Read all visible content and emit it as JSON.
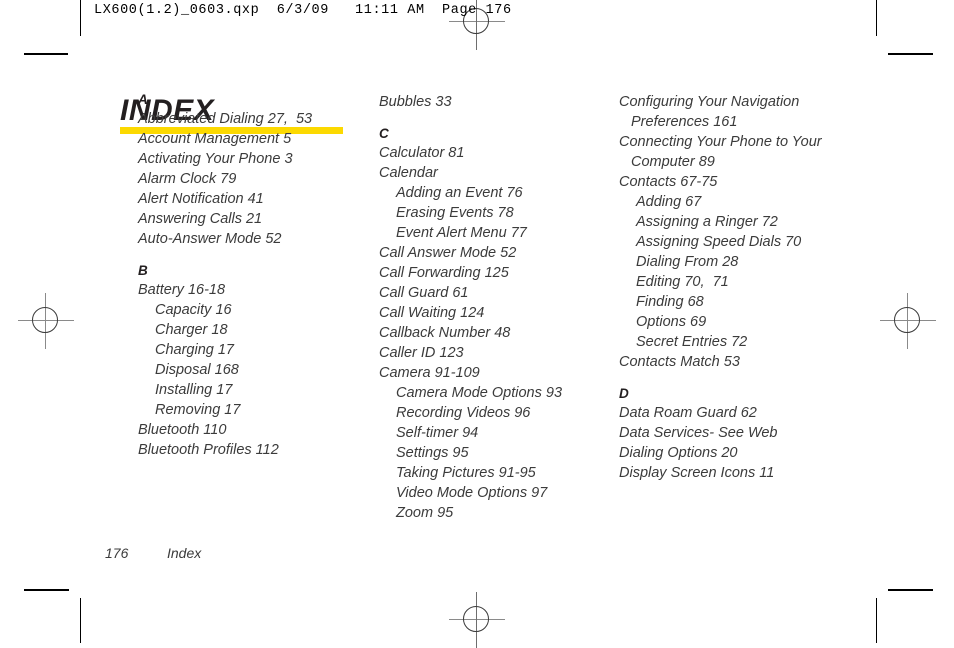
{
  "prepress": {
    "header_text": "LX600(1.2)_0603.qxp  6/3/09   11:11 AM  Page 176"
  },
  "page": {
    "title": "INDEX",
    "footer": {
      "page_number": "176",
      "section_label": "Index"
    }
  },
  "columns": [
    {
      "id": "column-1",
      "blocks": [
        {
          "heading": "A",
          "entries": [
            {
              "text": "Abbreviated Dialing 27,  53",
              "level": 1
            },
            {
              "text": "Account Management 5",
              "level": 1
            },
            {
              "text": "Activating Your Phone 3",
              "level": 1
            },
            {
              "text": "Alarm Clock 79",
              "level": 1
            },
            {
              "text": "Alert Notification 41",
              "level": 1
            },
            {
              "text": "Answering Calls 21",
              "level": 1
            },
            {
              "text": "Auto-Answer Mode 52",
              "level": 1
            }
          ]
        },
        {
          "heading": "B",
          "entries": [
            {
              "text": "Battery 16-18",
              "level": 1
            },
            {
              "text": "Capacity 16",
              "level": 2
            },
            {
              "text": "Charger 18",
              "level": 2
            },
            {
              "text": "Charging 17",
              "level": 2
            },
            {
              "text": "Disposal 168",
              "level": 2
            },
            {
              "text": "Installing 17",
              "level": 2
            },
            {
              "text": "Removing 17",
              "level": 2
            },
            {
              "text": "Bluetooth 110",
              "level": 1
            },
            {
              "text": "Bluetooth Profiles 112",
              "level": 1
            }
          ]
        }
      ]
    },
    {
      "id": "column-2",
      "blocks": [
        {
          "heading": null,
          "entries": [
            {
              "text": "Bubbles 33",
              "level": 1
            }
          ]
        },
        {
          "heading": "C",
          "entries": [
            {
              "text": "Calculator 81",
              "level": 1
            },
            {
              "text": "Calendar",
              "level": 1
            },
            {
              "text": "Adding an Event 76",
              "level": 2
            },
            {
              "text": "Erasing Events 78",
              "level": 2
            },
            {
              "text": "Event Alert Menu 77",
              "level": 2
            },
            {
              "text": "Call Answer Mode 52",
              "level": 1
            },
            {
              "text": "Call Forwarding 125",
              "level": 1
            },
            {
              "text": "Call Guard 61",
              "level": 1
            },
            {
              "text": "Call Waiting 124",
              "level": 1
            },
            {
              "text": "Callback Number 48",
              "level": 1
            },
            {
              "text": "Caller ID 123",
              "level": 1
            },
            {
              "text": "Camera 91-109",
              "level": 1
            },
            {
              "text": "Camera Mode Options 93",
              "level": 2
            },
            {
              "text": "Recording Videos 96",
              "level": 2
            },
            {
              "text": "Self-timer 94",
              "level": 2
            },
            {
              "text": "Settings 95",
              "level": 2
            },
            {
              "text": "Taking Pictures 91-95",
              "level": 2
            },
            {
              "text": "Video Mode Options 97",
              "level": 2
            },
            {
              "text": "Zoom 95",
              "level": 2
            }
          ]
        }
      ]
    },
    {
      "id": "column-3",
      "blocks": [
        {
          "heading": null,
          "entries": [
            {
              "text": "Configuring Your Navigation Preferences 161",
              "level": 1,
              "wrap": true
            },
            {
              "text": "Connecting Your Phone to Your Computer 89",
              "level": 1,
              "wrap": true
            },
            {
              "text": "Contacts 67-75",
              "level": 1
            },
            {
              "text": "Adding 67",
              "level": 2
            },
            {
              "text": "Assigning a Ringer 72",
              "level": 2
            },
            {
              "text": "Assigning Speed Dials 70",
              "level": 2
            },
            {
              "text": "Dialing From 28",
              "level": 2
            },
            {
              "text": "Editing 70,  71",
              "level": 2
            },
            {
              "text": "Finding 68",
              "level": 2
            },
            {
              "text": "Options 69",
              "level": 2
            },
            {
              "text": "Secret Entries 72",
              "level": 2
            },
            {
              "text": "Contacts Match 53",
              "level": 1
            }
          ]
        },
        {
          "heading": "D",
          "entries": [
            {
              "text": "Data Roam Guard 62",
              "level": 1
            },
            {
              "text": "Data Services- See Web",
              "level": 1
            },
            {
              "text": "Dialing Options 20",
              "level": 1
            },
            {
              "text": "Display Screen Icons 11",
              "level": 1
            }
          ]
        }
      ]
    }
  ],
  "colors": {
    "title_rule": "#FCD900",
    "text": "#3B3B3B",
    "heading": "#231F20"
  }
}
